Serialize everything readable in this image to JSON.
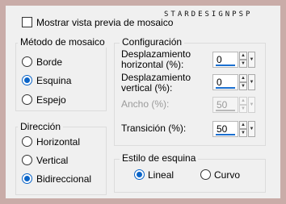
{
  "preview": {
    "label": "Mostrar vista previa de mosaico",
    "checked": false
  },
  "watermark": "STARDESIGNPSP",
  "tile_method": {
    "title": "Método de mosaico",
    "options": [
      "Borde",
      "Esquina",
      "Espejo"
    ],
    "selected": "Esquina"
  },
  "direction": {
    "title": "Dirección",
    "options": [
      "Horizontal",
      "Vertical",
      "Bidireccional"
    ],
    "selected": "Bidireccional"
  },
  "settings": {
    "title": "Configuración",
    "h_offset": {
      "label_line1": "Desplazamiento",
      "label_line2": "horizontal (%):",
      "value": "0"
    },
    "v_offset": {
      "label_line1": "Desplazamiento",
      "label_line2": "vertical (%):",
      "value": "0"
    },
    "width": {
      "label": "Ancho (%):",
      "value": "50",
      "enabled": false
    },
    "transition": {
      "label": "Transición (%):",
      "value": "50"
    }
  },
  "corner_style": {
    "title": "Estilo de esquina",
    "options": [
      "Lineal",
      "Curvo"
    ],
    "selected": "Lineal"
  },
  "colors": {
    "frame": "#c9aca8",
    "panel": "#f0f0f0",
    "accent": "#0a64c8"
  }
}
